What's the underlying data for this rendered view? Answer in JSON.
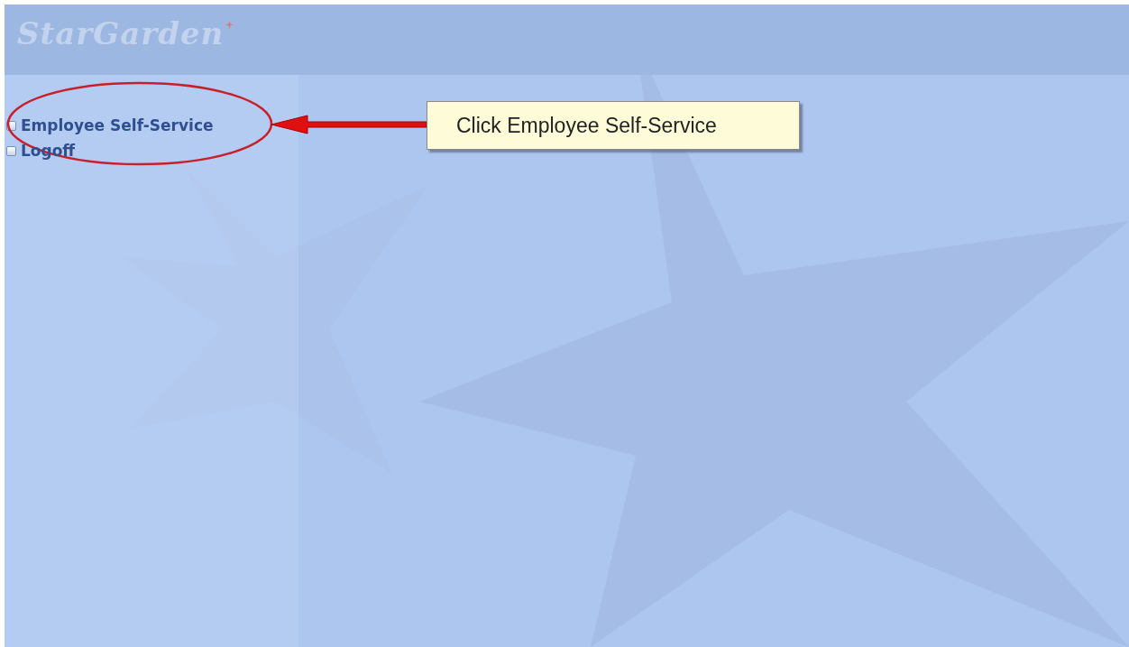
{
  "header": {
    "logo": "StarGarden"
  },
  "menu": [
    {
      "label": "Employee Self-Service",
      "highlighted": true
    },
    {
      "label": "Logoff",
      "highlighted": false
    }
  ],
  "callout": {
    "text": "Click Employee Self-Service"
  }
}
